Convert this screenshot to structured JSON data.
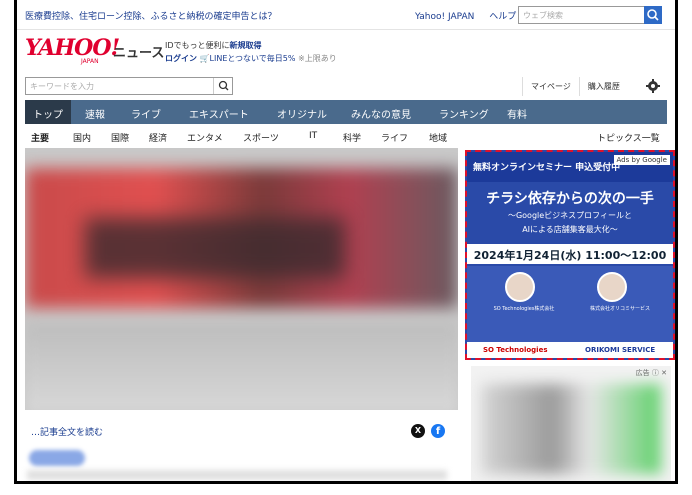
{
  "topbar": {
    "promo": "医療費控除、住宅ローン控除、ふるさと納税の確定申告とは？",
    "links": [
      "Yahoo! JAPAN",
      "ヘルプ"
    ],
    "search_placeholder": "ウェブ検索"
  },
  "brand": {
    "logo": "YAHOO!",
    "logo_sub": "JAPAN",
    "section": "ニュース"
  },
  "id_promo": {
    "line1_prefix": "IDでもっと便利に",
    "line1_link": "新規取得",
    "login": "ログイン",
    "line2": "LINEとつないで毎日5%",
    "line2_note": "※上限あり"
  },
  "search": {
    "placeholder": "キーワードを入力"
  },
  "user_links": [
    "マイページ",
    "購入履歴"
  ],
  "nav": {
    "items": [
      "トップ",
      "速報",
      "ライブ",
      "エキスパート",
      "オリジナル",
      "みんなの意見",
      "ランキング",
      "有料"
    ]
  },
  "subnav": {
    "items": [
      "主要",
      "国内",
      "国際",
      "経済",
      "エンタメ",
      "スポーツ",
      "IT",
      "科学",
      "ライフ",
      "地域"
    ],
    "topics": "トピックス一覧"
  },
  "article": {
    "read_more": "…記事全文を読む"
  },
  "ad": {
    "seminar": "無料オンラインセミナー 申込受付中",
    "ads_by": "Ads by Google",
    "headline": "チラシ依存からの次の一手",
    "sub1": "〜Googleビジネスプロフィールと",
    "sub2": "AIによる店舗集客最大化〜",
    "date": "2024年1月24日(水) 11:00〜12:00",
    "company1": "SO Technologies株式会社",
    "company2": "株式会社オリコミサービス",
    "logo1": "SO Technologies",
    "logo2": "ORIKOMI SERVICE"
  },
  "ad2": {
    "meta": "広告 ⓘ ✕"
  }
}
